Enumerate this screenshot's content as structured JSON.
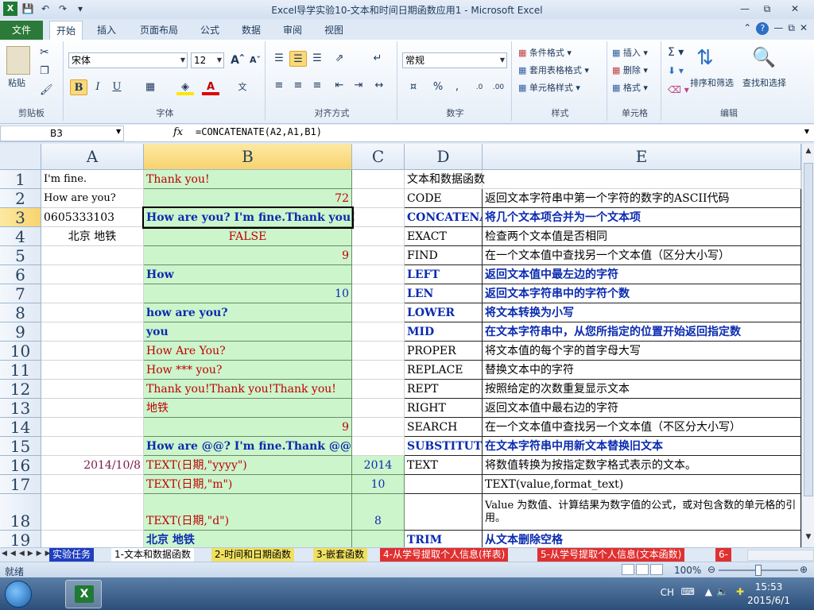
{
  "window": {
    "title": "Excel导学实验10-文本和时间日期函数应用1 - Microsoft Excel"
  },
  "ribbon_tabs": [
    "文件",
    "开始",
    "插入",
    "页面布局",
    "公式",
    "数据",
    "审阅",
    "视图"
  ],
  "ribbon": {
    "clipboard": {
      "paste": "粘贴",
      "label": "剪贴板"
    },
    "font": {
      "name": "宋体",
      "size": "12",
      "label": "字体",
      "bold": "B",
      "italic": "I",
      "underline": "U"
    },
    "alignment": {
      "label": "对齐方式"
    },
    "number": {
      "format": "常规",
      "label": "数字",
      "percent": "%",
      "comma": ",",
      "inc": ".0→.00",
      "dec": ".00→.0"
    },
    "styles": {
      "conditional": "条件格式",
      "table": "套用表格格式",
      "cell": "单元格样式",
      "label": "样式"
    },
    "cells": {
      "insert": "插入",
      "delete": "删除",
      "format": "格式",
      "label": "单元格"
    },
    "editing": {
      "sum": "Σ",
      "sort": "排序和筛选",
      "find": "查找和选择",
      "label": "编辑"
    }
  },
  "formula_bar": {
    "name_box": "B3",
    "fx": "fx",
    "formula": "=CONCATENATE(A2,A1,B1)"
  },
  "columns": [
    "A",
    "B",
    "C",
    "D",
    "E"
  ],
  "rows": [
    "1",
    "2",
    "3",
    "4",
    "5",
    "6",
    "7",
    "8",
    "9",
    "10",
    "11",
    "12",
    "13",
    "14",
    "15",
    "16",
    "17",
    "18",
    "19"
  ],
  "cells": {
    "A1": "I'm fine.",
    "A2": "How are you?",
    "A3": "0605333103",
    "A4": "北京  地铁",
    "A16": "2014/10/8",
    "B1": "Thank you!",
    "B2": "72",
    "B3": "How are you? I'm fine.Thank you!",
    "B4": "FALSE",
    "B5": "9",
    "B6": "How",
    "B7": "10",
    "B8": "how are you?",
    "B9": "you",
    "B10": "How Are You?",
    "B11": "How *** you?",
    "B12": "Thank you!Thank you!Thank you!",
    "B13": "地铁",
    "B14": "9",
    "B15": "How are @@? I'm fine.Thank @@!",
    "B16": "TEXT(日期,\"yyyy\")",
    "B17": "TEXT(日期,\"m\")",
    "B18": "TEXT(日期,\"d\")",
    "B19": "北京 地铁",
    "C16": "2014",
    "C17": "10",
    "C18": "8",
    "D1": "文本和数据函数",
    "D2": "CODE",
    "D3": "CONCATENATE",
    "D4": "EXACT",
    "D5": "FIND",
    "D6": "LEFT",
    "D7": "LEN",
    "D8": "LOWER",
    "D9": "MID",
    "D10": "PROPER",
    "D11": "REPLACE",
    "D12": "REPT",
    "D13": "RIGHT",
    "D14": "SEARCH",
    "D15": "SUBSTITUTE",
    "D16": "TEXT",
    "D19": "TRIM",
    "E2": "返回文本字符串中第一个字符的数字的ASCII代码",
    "E3": "将几个文本项合并为一个文本项",
    "E4": "检查两个文本值是否相同",
    "E5": "在一个文本值中查找另一个文本值（区分大小写）",
    "E6": "返回文本值中最左边的字符",
    "E7": "返回文本字符串中的字符个数",
    "E8": "将文本转换为小写",
    "E9": "在文本字符串中，从您所指定的位置开始返回指定数",
    "E10": "将文本值的每个字的首字母大写",
    "E11": "替换文本中的字符",
    "E12": "按照给定的次数重复显示文本",
    "E13": "返回文本值中最右边的字符",
    "E14": "在一个文本值中查找另一个文本值（不区分大小写）",
    "E15": "在文本字符串中用新文本替换旧文本",
    "E16": "将数值转换为按指定数字格式表示的文本。",
    "E17": "TEXT(value,format_text)",
    "E18": "Value    为数值、计算结果为数字值的公式，或对包含数的单元格的引用。",
    "E19": "从文本删除空格"
  },
  "sheet_tabs": [
    {
      "label": "实验任务",
      "color": "#1f3fbf"
    },
    {
      "label": "1-文本和数据函数",
      "color": "#ffffff"
    },
    {
      "label": "2-时间和日期函数",
      "color": "#f0e060"
    },
    {
      "label": "3-嵌套函数",
      "color": "#f0e060"
    },
    {
      "label": "4-从学号提取个人信息(样表)",
      "color": "#e03030"
    },
    {
      "label": "5-从学号提取个人信息(文本函数)",
      "color": "#e03030"
    },
    {
      "label": "6-",
      "color": "#e03030"
    }
  ],
  "status": {
    "ready": "就绪",
    "zoom": "100%"
  },
  "taskbar": {
    "ime": "CH",
    "time": "15:53",
    "date": "2015/6/1"
  }
}
